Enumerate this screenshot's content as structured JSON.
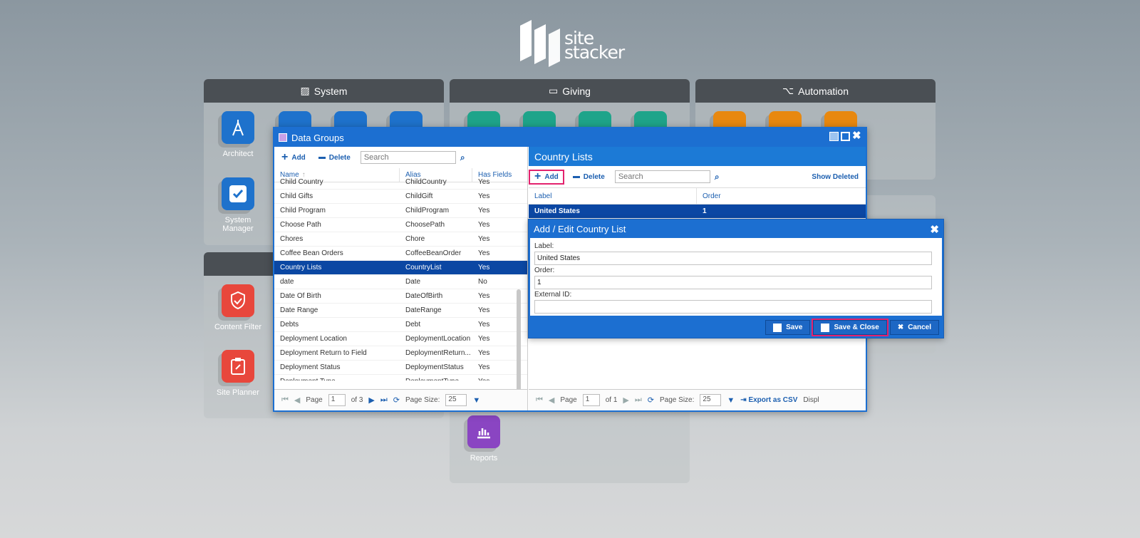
{
  "logo": {
    "line1": "site",
    "line2": "stacker"
  },
  "panels": {
    "system": {
      "title": "System",
      "tiles": [
        {
          "label": "Architect"
        },
        {
          "label": "System Manager"
        }
      ]
    },
    "giving": {
      "title": "Giving"
    },
    "automation": {
      "title": "Automation"
    },
    "content": {
      "tiles": [
        {
          "label": "Content Filter"
        },
        {
          "label": "Site Planner"
        }
      ]
    },
    "reports": {
      "label": "Reports"
    }
  },
  "window": {
    "title": "Data Groups",
    "left": {
      "add_label": "Add",
      "delete_label": "Delete",
      "search_placeholder": "Search",
      "columns": [
        "Name",
        "Alias",
        "Has Fields"
      ],
      "rows": [
        [
          "Child Country",
          "ChildCountry",
          "Yes"
        ],
        [
          "Child Gifts",
          "ChildGift",
          "Yes"
        ],
        [
          "Child Program",
          "ChildProgram",
          "Yes"
        ],
        [
          "Choose Path",
          "ChoosePath",
          "Yes"
        ],
        [
          "Chores",
          "Chore",
          "Yes"
        ],
        [
          "Coffee Bean Orders",
          "CoffeeBeanOrder",
          "Yes"
        ],
        [
          "Country Lists",
          "CountryList",
          "Yes"
        ],
        [
          "date",
          "Date",
          "No"
        ],
        [
          "Date Of Birth",
          "DateOfBirth",
          "Yes"
        ],
        [
          "Date Range",
          "DateRange",
          "Yes"
        ],
        [
          "Debts",
          "Debt",
          "Yes"
        ],
        [
          "Deployment Location",
          "DeploymentLocation",
          "Yes"
        ],
        [
          "Deployment Return to Field",
          "DeploymentReturn...",
          "Yes"
        ],
        [
          "Deployment Status",
          "DeploymentStatus",
          "Yes"
        ],
        [
          "Deployment Type",
          "DeploymentType",
          "Yes"
        ]
      ],
      "selected_index": 6,
      "pager": {
        "page_label": "Page",
        "page": "1",
        "of": "of 3",
        "size_label": "Page Size:",
        "size": "25"
      }
    },
    "right": {
      "title": "Country Lists",
      "add_label": "Add",
      "delete_label": "Delete",
      "search_placeholder": "Search",
      "show_deleted": "Show Deleted",
      "columns": [
        "Label",
        "Order"
      ],
      "rows": [
        [
          "United States",
          "1"
        ]
      ],
      "pager": {
        "page_label": "Page",
        "page": "1",
        "of": "of 1",
        "size_label": "Page Size:",
        "size": "25",
        "export": "Export as CSV",
        "display": "Displ"
      }
    }
  },
  "dialog": {
    "title": "Add / Edit Country List",
    "label_label": "Label:",
    "label_value": "United States",
    "order_label": "Order:",
    "order_value": "1",
    "extid_label": "External ID:",
    "extid_value": "",
    "save": "Save",
    "save_close": "Save & Close",
    "cancel": "Cancel"
  },
  "colors": {
    "accent": "#1c6fd1",
    "selected": "#0b47a3",
    "highlight": "#e3226e"
  }
}
